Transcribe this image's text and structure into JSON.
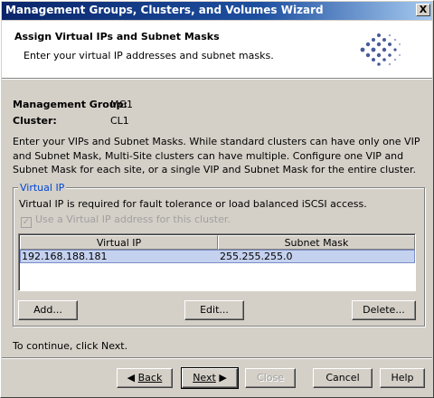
{
  "window": {
    "title": "Management Groups, Clusters, and Volumes Wizard",
    "close_glyph": "X"
  },
  "header": {
    "title": "Assign Virtual IPs and Subnet Masks",
    "subtitle": "Enter your virtual IP addresses and subnet masks.",
    "logo_icon": "dot-diamond-logo"
  },
  "info": {
    "management_group_label": "Management Group:",
    "management_group_value": "MG1",
    "cluster_label": "Cluster:",
    "cluster_value": "CL1"
  },
  "description": "Enter your VIPs and Subnet Masks. While standard clusters can have only one VIP and Subnet Mask, Multi-Site clusters can have multiple. Configure one VIP and Subnet Mask for each site, or a single VIP and Subnet Mask for the entire cluster.",
  "virtual_ip_group": {
    "legend": "Virtual IP",
    "note": "Virtual IP is required for fault tolerance or load balanced iSCSI access.",
    "checkbox_label": "Use a Virtual IP address for this cluster.",
    "checkbox_checked": true,
    "columns": [
      "Virtual IP",
      "Subnet Mask"
    ],
    "rows": [
      {
        "virtual_ip": "192.168.188.181",
        "subnet_mask": "255.255.255.0"
      }
    ],
    "add_label": "Add...",
    "edit_label": "Edit...",
    "delete_label": "Delete..."
  },
  "continue_text": "To continue, click Next.",
  "footer": {
    "back_label": "Back",
    "next_label": "Next",
    "close_label": "Close",
    "cancel_label": "Cancel",
    "help_label": "Help"
  },
  "colors": {
    "title_bar": "#0a246a",
    "selection": "#c5d2ef",
    "legend_text": "#0046d5",
    "dialog_bg": "#d4d0c8"
  }
}
